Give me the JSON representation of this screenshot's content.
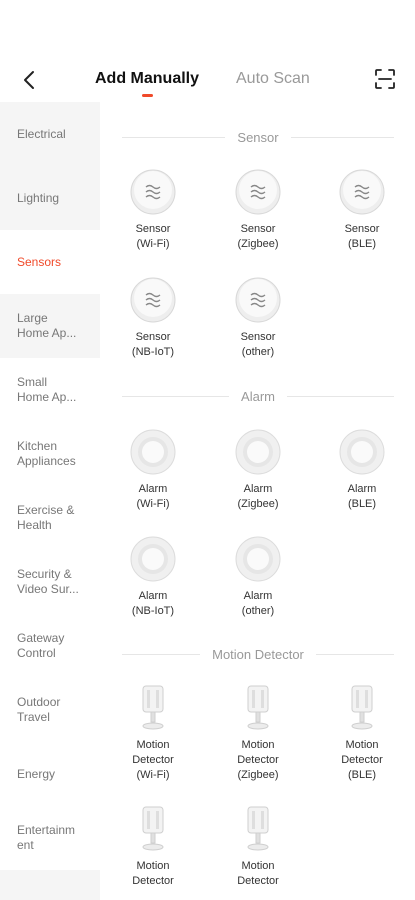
{
  "header": {
    "tab_add": "Add Manually",
    "tab_auto": "Auto Scan"
  },
  "sidebar": {
    "items": [
      {
        "label": "Electrical"
      },
      {
        "label": "Lighting"
      },
      {
        "label": "Sensors",
        "active": true
      },
      {
        "label": "Large\nHome Ap..."
      },
      {
        "label": "Small\nHome Ap..."
      },
      {
        "label": "Kitchen\nAppliances"
      },
      {
        "label": "Exercise &\nHealth"
      },
      {
        "label": "Security &\nVideo Sur..."
      },
      {
        "label": "Gateway\nControl"
      },
      {
        "label": "Outdoor\nTravel"
      },
      {
        "label": "Energy"
      },
      {
        "label": "Entertainm\nent"
      }
    ]
  },
  "sections": [
    {
      "title": "Sensor",
      "items": [
        {
          "label": "Sensor\n(Wi-Fi)",
          "icon": "sensor-icon"
        },
        {
          "label": "Sensor\n(Zigbee)",
          "icon": "sensor-icon"
        },
        {
          "label": "Sensor\n(BLE)",
          "icon": "sensor-icon"
        },
        {
          "label": "Sensor\n(NB-IoT)",
          "icon": "sensor-icon"
        },
        {
          "label": "Sensor\n(other)",
          "icon": "sensor-icon"
        }
      ]
    },
    {
      "title": "Alarm",
      "items": [
        {
          "label": "Alarm\n(Wi-Fi)",
          "icon": "alarm-icon"
        },
        {
          "label": "Alarm\n(Zigbee)",
          "icon": "alarm-icon"
        },
        {
          "label": "Alarm\n(BLE)",
          "icon": "alarm-icon"
        },
        {
          "label": "Alarm\n(NB-IoT)",
          "icon": "alarm-icon"
        },
        {
          "label": "Alarm\n(other)",
          "icon": "alarm-icon"
        }
      ]
    },
    {
      "title": "Motion Detector",
      "items": [
        {
          "label": "Motion\nDetector\n(Wi-Fi)",
          "icon": "motion-detector-icon"
        },
        {
          "label": "Motion\nDetector\n(Zigbee)",
          "icon": "motion-detector-icon"
        },
        {
          "label": "Motion\nDetector\n(BLE)",
          "icon": "motion-detector-icon"
        },
        {
          "label": "Motion\nDetector",
          "icon": "motion-detector-icon"
        },
        {
          "label": "Motion\nDetector",
          "icon": "motion-detector-icon"
        }
      ]
    }
  ],
  "colors": {
    "accent": "#f04a2a"
  }
}
